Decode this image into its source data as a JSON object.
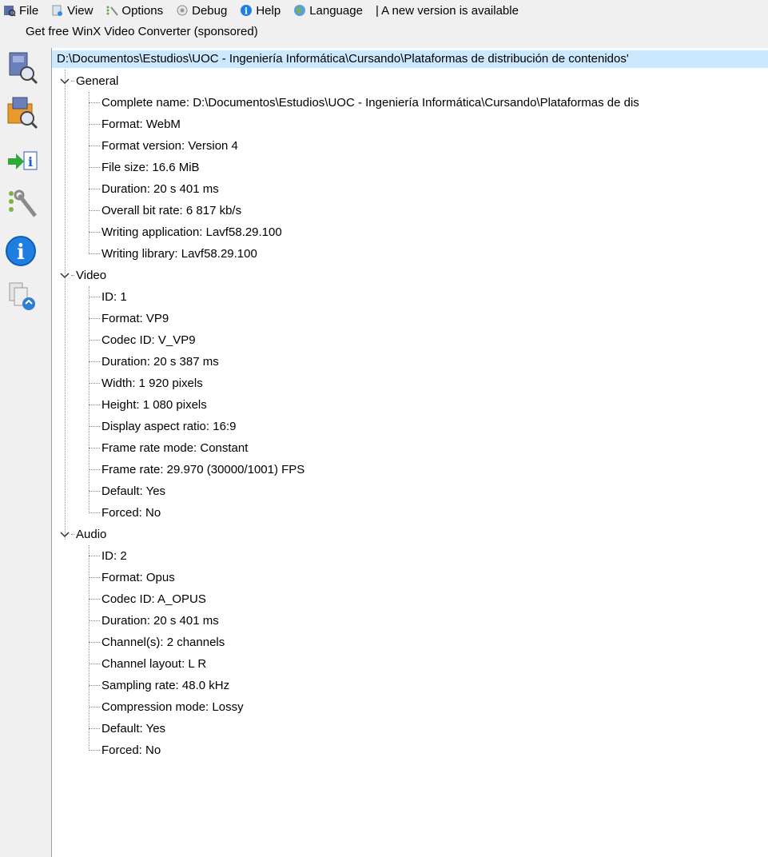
{
  "menubar": {
    "items": [
      {
        "label": "File",
        "icon": "file-icon"
      },
      {
        "label": "View",
        "icon": "view-icon"
      },
      {
        "label": "Options",
        "icon": "options-icon"
      },
      {
        "label": "Debug",
        "icon": "debug-icon"
      },
      {
        "label": "Help",
        "icon": "help-icon"
      },
      {
        "label": "Language",
        "icon": "language-icon"
      }
    ],
    "notice": "| A new version is available"
  },
  "sponsor": {
    "label": "Get free WinX Video Converter (sponsored)"
  },
  "toolbar": {
    "buttons": [
      "open-file-icon",
      "open-folder-icon",
      "export-icon",
      "preferences-icon",
      "about-icon",
      "web-update-icon"
    ]
  },
  "tree": {
    "root": "D:\\Documentos\\Estudios\\UOC - Ingeniería Informática\\Cursando\\Plataformas de distribución de contenidos'",
    "sections": [
      {
        "title": "General",
        "items": [
          "Complete name: D:\\Documentos\\Estudios\\UOC - Ingeniería Informática\\Cursando\\Plataformas de dis",
          "Format: WebM",
          "Format version: Version 4",
          "File size: 16.6 MiB",
          "Duration: 20 s 401 ms",
          "Overall bit rate: 6 817 kb/s",
          "Writing application: Lavf58.29.100",
          "Writing library: Lavf58.29.100"
        ]
      },
      {
        "title": "Video",
        "items": [
          "ID: 1",
          "Format: VP9",
          "Codec ID: V_VP9",
          "Duration: 20 s 387 ms",
          "Width: 1 920 pixels",
          "Height: 1 080 pixels",
          "Display aspect ratio: 16:9",
          "Frame rate mode: Constant",
          "Frame rate: 29.970 (30000/1001) FPS",
          "Default: Yes",
          "Forced: No"
        ]
      },
      {
        "title": "Audio",
        "items": [
          "ID: 2",
          "Format: Opus",
          "Codec ID: A_OPUS",
          "Duration: 20 s 401 ms",
          "Channel(s): 2 channels",
          "Channel layout: L R",
          "Sampling rate: 48.0 kHz",
          "Compression mode: Lossy",
          "Default: Yes",
          "Forced: No"
        ]
      }
    ]
  }
}
